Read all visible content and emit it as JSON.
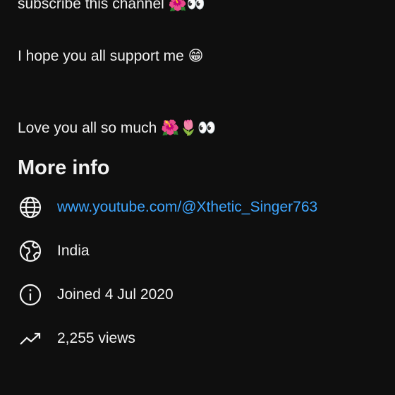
{
  "description": {
    "line1": "subscribe this channel 🌺👀",
    "line2": "I hope you all support me 😁",
    "line3": "Love you all so much 🌺🌷👀"
  },
  "more_info": {
    "title": "More info",
    "link": {
      "icon": "globe-icon",
      "text": "www.youtube.com/@Xthetic_Singer763"
    },
    "country": {
      "icon": "earth-location-icon",
      "text": "India"
    },
    "joined": {
      "icon": "info-icon",
      "text": "Joined 4 Jul 2020"
    },
    "views": {
      "icon": "trending-icon",
      "text": "2,255 views"
    }
  },
  "colors": {
    "background": "#0f0f0f",
    "text": "#f1f1f1",
    "link": "#3ea6ff"
  }
}
